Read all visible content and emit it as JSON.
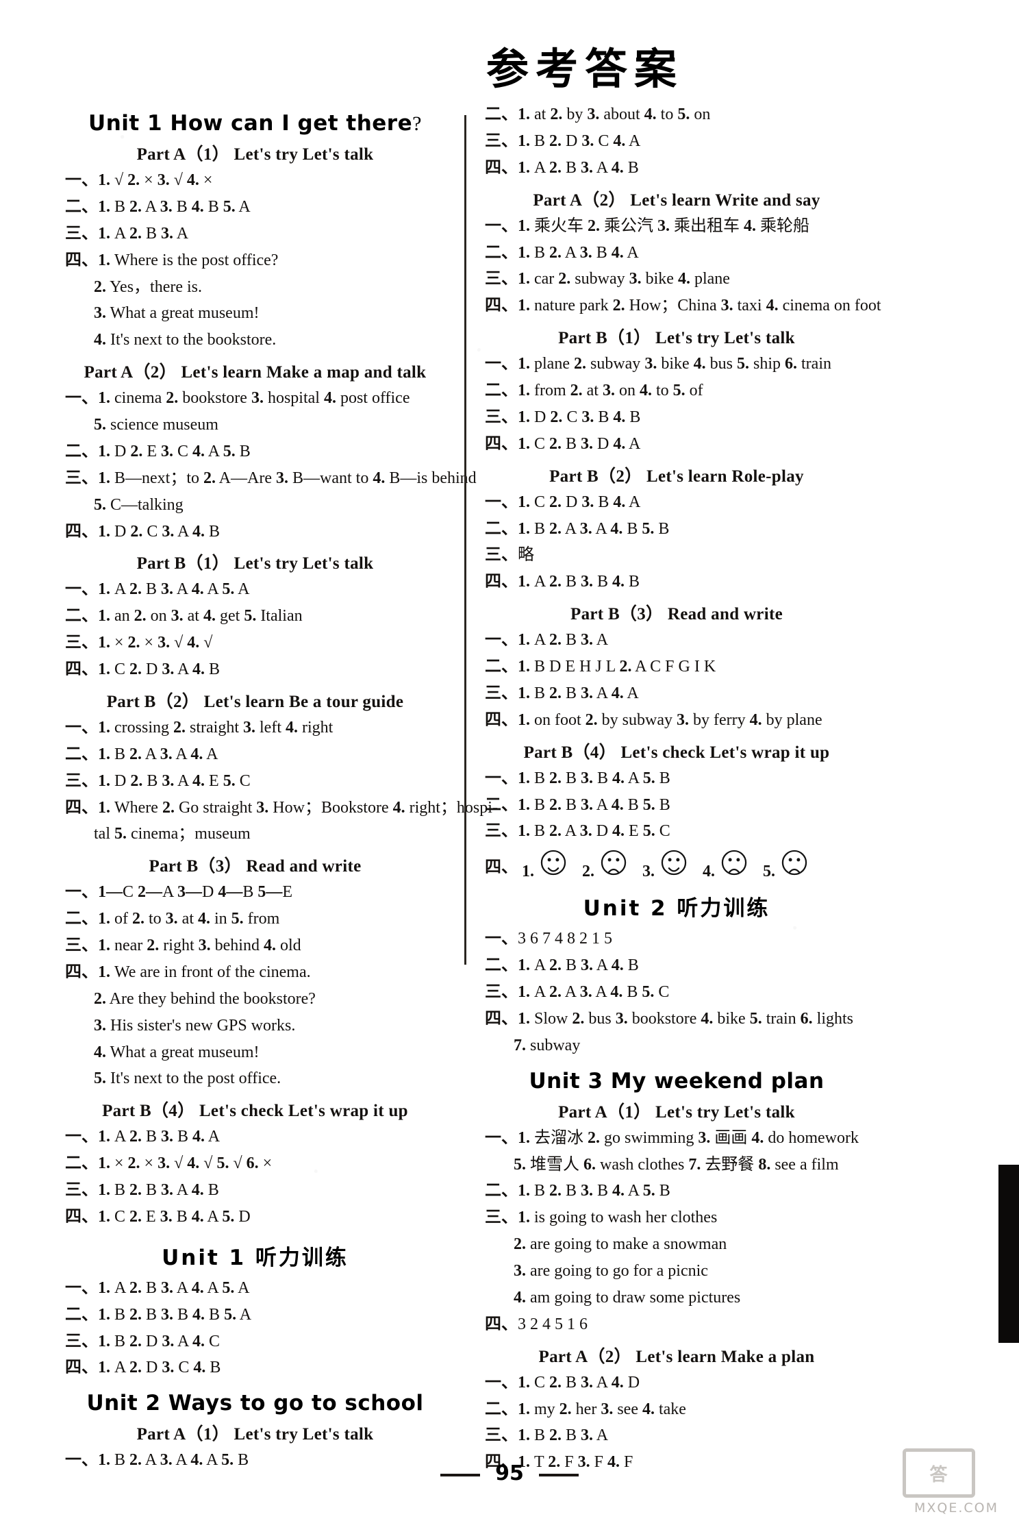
{
  "page": {
    "title": "参考答案",
    "folio": "95",
    "watermark_box": "答",
    "watermark_text": "MXQE.COM"
  },
  "left_column": [
    {
      "type": "unit",
      "text": "Unit 1   How can I get there",
      "suffix": "?"
    },
    {
      "type": "part",
      "text": "Part A（1）  Let's try   Let's talk"
    },
    {
      "type": "line",
      "text": "一、1. √  2. ×  3. √  4. ×"
    },
    {
      "type": "line",
      "text": "二、1. B  2. A  3. B  4. B  5. A"
    },
    {
      "type": "line",
      "text": "三、1. A  2. B  3. A"
    },
    {
      "type": "line",
      "text": "四、1. Where is the post office?"
    },
    {
      "type": "line",
      "indent": true,
      "text": "2. Yes，there is."
    },
    {
      "type": "line",
      "indent": true,
      "text": "3. What a great museum!"
    },
    {
      "type": "line",
      "indent": true,
      "text": "4. It's next to the bookstore."
    },
    {
      "type": "part",
      "text": "Part A（2）  Let's learn   Make a map and talk"
    },
    {
      "type": "line",
      "text": "一、1. cinema  2. bookstore  3. hospital  4. post office"
    },
    {
      "type": "line",
      "indent": true,
      "text": "5. science museum"
    },
    {
      "type": "line",
      "text": "二、1. D  2. E  3. C  4. A  5. B"
    },
    {
      "type": "line",
      "text": "三、1. B—next；to  2. A—Are  3. B—want to  4. B—is behind"
    },
    {
      "type": "line",
      "indent": true,
      "text": "5. C—talking"
    },
    {
      "type": "line",
      "text": "四、1. D  2. C  3. A  4. B"
    },
    {
      "type": "part",
      "text": "Part B（1）  Let's try   Let's talk"
    },
    {
      "type": "line",
      "text": "一、1. A  2. B  3. A  4. A  5. A"
    },
    {
      "type": "line",
      "text": "二、1. an  2. on  3. at  4. get  5. Italian"
    },
    {
      "type": "line",
      "text": "三、1. ×  2. ×  3. √  4. √"
    },
    {
      "type": "line",
      "text": "四、1. C  2. D  3. A  4. B"
    },
    {
      "type": "part",
      "text": "Part B（2）  Let's learn   Be a tour guide"
    },
    {
      "type": "line",
      "text": "一、1. crossing  2. straight  3. left  4. right"
    },
    {
      "type": "line",
      "text": "二、1. B  2. A  3. A  4. A"
    },
    {
      "type": "line",
      "text": "三、1. D  2. B  3. A  4. E  5. C"
    },
    {
      "type": "line",
      "text": "四、1. Where  2. Go straight  3. How；Bookstore  4. right；hospi-"
    },
    {
      "type": "line",
      "indent": true,
      "text": "tal  5. cinema；museum"
    },
    {
      "type": "part",
      "text": "Part B（3）   Read and write"
    },
    {
      "type": "line",
      "text": "一、1—C  2—A  3—D  4—B  5—E"
    },
    {
      "type": "line",
      "text": "二、1. of  2. to  3. at  4. in  5. from"
    },
    {
      "type": "line",
      "text": "三、1. near  2. right  3. behind  4. old"
    },
    {
      "type": "line",
      "text": "四、1. We are in front of the cinema."
    },
    {
      "type": "line",
      "indent": true,
      "text": "2. Are they behind the bookstore?"
    },
    {
      "type": "line",
      "indent": true,
      "text": "3. His sister's new GPS works."
    },
    {
      "type": "line",
      "indent": true,
      "text": "4. What a great museum!"
    },
    {
      "type": "line",
      "indent": true,
      "text": "5. It's next to the post office."
    },
    {
      "type": "part",
      "text": "Part B（4）  Let's check   Let's wrap it up"
    },
    {
      "type": "line",
      "text": "一、1. A  2. B  3. B  4. A"
    },
    {
      "type": "line",
      "text": "二、1. ×  2. ×  3. √  4. √  5. √  6. ×"
    },
    {
      "type": "line",
      "text": "三、1. B  2. B  3. A  4. B"
    },
    {
      "type": "line",
      "text": "四、1. C  2. E  3. B  4. A  5. D"
    },
    {
      "type": "unit_zh",
      "text": "Unit 1   听力训练"
    },
    {
      "type": "line",
      "text": "一、1. A  2. B  3. A  4. A  5. A"
    },
    {
      "type": "line",
      "text": "二、1. B  2. B  3. B  4. B  5. A"
    },
    {
      "type": "line",
      "text": "三、1. B  2. D  3. A  4. C"
    },
    {
      "type": "line",
      "text": "四、1. A  2. D  3. C  4. B"
    },
    {
      "type": "unit",
      "text": "Unit 2   Ways to go to school"
    },
    {
      "type": "part",
      "text": "Part A（1）  Let's try   Let's talk"
    },
    {
      "type": "line",
      "text": "一、1. B  2. A  3. A  4. A  5. B"
    }
  ],
  "right_column": [
    {
      "type": "line",
      "text": "二、1. at  2. by  3. about  4. to  5. on"
    },
    {
      "type": "line",
      "text": "三、1. B  2. D  3. C  4. A"
    },
    {
      "type": "line",
      "text": "四、1. A  2. B  3. A  4. B"
    },
    {
      "type": "part",
      "text": "Part A（2）  Let's learn   Write and say"
    },
    {
      "type": "line",
      "text": "一、1. 乘火车  2. 乘公汽  3. 乘出租车  4. 乘轮船"
    },
    {
      "type": "line",
      "text": "二、1. B  2. A  3. B  4. A"
    },
    {
      "type": "line",
      "text": "三、1. car  2. subway  3. bike  4. plane"
    },
    {
      "type": "line",
      "text": "四、1. nature park  2. How；China  3. taxi  4. cinema on foot"
    },
    {
      "type": "part",
      "text": "Part B（1）  Let's try   Let's talk"
    },
    {
      "type": "line",
      "text": "一、1. plane  2. subway  3. bike  4. bus  5. ship  6. train"
    },
    {
      "type": "line",
      "text": "二、1. from  2. at  3. on  4. to  5. of"
    },
    {
      "type": "line",
      "text": "三、1. D  2. C  3. B  4. B"
    },
    {
      "type": "line",
      "text": "四、1. C  2. B  3. D  4. A"
    },
    {
      "type": "part",
      "text": "Part B（2）  Let's learn   Role-play"
    },
    {
      "type": "line",
      "text": "一、1. C  2. D  3. B  4. A"
    },
    {
      "type": "line",
      "text": "二、1. B  2. A  3. A  4. B  5. B"
    },
    {
      "type": "line",
      "text": "三、略"
    },
    {
      "type": "line",
      "text": "四、1. A  2. B  3. B  4. B"
    },
    {
      "type": "part",
      "text": "Part B（3）   Read and write"
    },
    {
      "type": "line",
      "text": "一、1. A  2. B  3. A"
    },
    {
      "type": "line",
      "text": "二、1. B D E H J L  2. A C F G I K"
    },
    {
      "type": "line",
      "text": "三、1. B  2. B  3. A  4. A"
    },
    {
      "type": "line",
      "text": "四、1. on foot  2. by subway  3. by ferry  4. by plane"
    },
    {
      "type": "part",
      "text": "Part B（4）  Let's check   Let's wrap it up"
    },
    {
      "type": "line",
      "text": "一、1. B  2. B  3. B  4. A  5. B"
    },
    {
      "type": "line",
      "text": "二、1. B  2. B  3. A  4. B  5. B"
    },
    {
      "type": "line",
      "text": "三、1. B  2. A  3. D  4. E  5. C"
    },
    {
      "type": "faces",
      "label": "四、",
      "items": [
        {
          "num": "1.",
          "mood": "happy"
        },
        {
          "num": "2.",
          "mood": "sad"
        },
        {
          "num": "3.",
          "mood": "happy"
        },
        {
          "num": "4.",
          "mood": "sad"
        },
        {
          "num": "5.",
          "mood": "sad"
        }
      ]
    },
    {
      "type": "unit_zh",
      "text": "Unit 2   听力训练"
    },
    {
      "type": "line",
      "text": "一、3  6  7  4  8  2  1  5"
    },
    {
      "type": "line",
      "text": "二、1. A  2. B  3. A  4. B"
    },
    {
      "type": "line",
      "text": "三、1. A  2. A  3. A  4. B  5. C"
    },
    {
      "type": "line",
      "text": "四、1. Slow  2. bus  3. bookstore  4. bike  5. train  6. lights"
    },
    {
      "type": "line",
      "indent": true,
      "text": "7. subway"
    },
    {
      "type": "unit",
      "text": "Unit 3   My weekend plan"
    },
    {
      "type": "part",
      "text": "Part A（1）  Let's try   Let's talk"
    },
    {
      "type": "line",
      "text": "一、1. 去溜冰  2. go swimming  3. 画画  4. do homework"
    },
    {
      "type": "line",
      "indent": true,
      "text": "5. 堆雪人  6. wash clothes  7. 去野餐  8. see a film"
    },
    {
      "type": "line",
      "text": "二、1. B  2. B  3. B  4. A  5. B"
    },
    {
      "type": "line",
      "text": "三、1. is going to wash her clothes"
    },
    {
      "type": "line",
      "indent": true,
      "text": "2. are going to make a snowman"
    },
    {
      "type": "line",
      "indent": true,
      "text": "3. are going to go for a picnic"
    },
    {
      "type": "line",
      "indent": true,
      "text": "4. am going to draw some pictures"
    },
    {
      "type": "line",
      "text": "四、3  2  4  5  1  6"
    },
    {
      "type": "part",
      "text": "Part A（2）  Let's learn   Make a plan"
    },
    {
      "type": "line",
      "text": "一、1. C  2. B  3. A  4. D"
    },
    {
      "type": "line",
      "text": "二、1. my  2. her  3. see  4. take"
    },
    {
      "type": "line",
      "text": "三、1. B  2. B  3. A"
    },
    {
      "type": "line",
      "text": "四、1. T  2. F  3. F  4. F"
    }
  ]
}
